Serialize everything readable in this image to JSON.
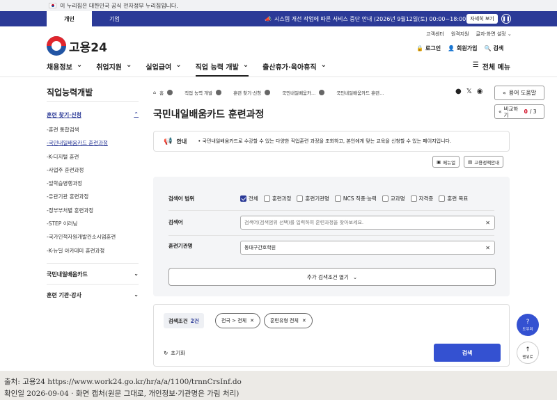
{
  "gov_bar": {
    "text": "이 누리집은 대한민국 공식 전자정부 누리집입니다."
  },
  "notice": {
    "tab_member": "개인",
    "tab_business": "기업",
    "message": "시스템 개선 작업에 따른 서비스 중단 안내 (2026년 9월12일(토) 00:00~18:00)",
    "more_label": "자세히 보기",
    "pause_icon": "pause-icon"
  },
  "util_links": [
    "고객센터",
    "원격지원",
    "글자·화면 설정"
  ],
  "logo": {
    "text": "고용24"
  },
  "user_tools": {
    "login": "로그인",
    "signup": "회원가입",
    "search": "검색"
  },
  "gnb": {
    "items": [
      "채용정보",
      "취업지원",
      "실업급여",
      "직업 능력 개발",
      "출산휴가·육아휴직"
    ],
    "active_index": 3,
    "all_menu": "전체 메뉴"
  },
  "lnb": {
    "title": "직업능력개발",
    "group_head": "훈련 찾기·신청",
    "sub_items": [
      "-훈련 통합검색",
      "-국민내일배움카드 훈련과정",
      "-K-디지털 훈련",
      "-사업주 훈련과정",
      "-일학습병행과정",
      "-유관기관 훈련과정",
      "-정부부처별 훈련과정",
      "-STEP 이러닝",
      "-국가인적자원개발컨소시엄훈련",
      "-K-뉴딜 아카데미 훈련과정"
    ],
    "active_sub_index": 1,
    "groups": [
      "국민내일배움카드",
      "훈련 기관·강사"
    ]
  },
  "breadcrumb": [
    "홈",
    "직업 능력 개발",
    "훈련 찾기·신청",
    "국민내일배움카...",
    "국민내일배움카드 훈련..."
  ],
  "header_tools": {
    "help_label": "용어 도움말",
    "compare_label": "비교하기",
    "compare_count": "0",
    "compare_total": "/ 3"
  },
  "page": {
    "title": "국민내일배움카드 훈련과정"
  },
  "info": {
    "label": "안내",
    "text": "• 국민내일배움카드로 수강할 수 있는 다양한 직업훈련 과정을 조회하고, 본인에게 맞는 교육을 신청할 수 있는 페이지입니다."
  },
  "doc_buttons": [
    "메뉴얼",
    "고용정책안내"
  ],
  "search": {
    "scope_label": "검색어 범위",
    "scope_options": [
      {
        "label": "전체",
        "checked": true
      },
      {
        "label": "훈련과정",
        "checked": false
      },
      {
        "label": "훈련기관명",
        "checked": false
      },
      {
        "label": "NCS 직종·능력",
        "checked": false
      },
      {
        "label": "교과명",
        "checked": false
      },
      {
        "label": "자격증",
        "checked": false
      },
      {
        "label": "훈련 목표",
        "checked": false
      }
    ],
    "keyword_label": "검색어",
    "keyword_placeholder": "검색어(검색범위 선택)를 입력하여 훈련과정을 찾아보세요.",
    "institution_label": "훈련기관명",
    "institution_value": "동대구간호학원",
    "more_conditions": "추가 검색조건 열기"
  },
  "conditions": {
    "label": "검색조건",
    "count": "2건",
    "chips": [
      "전국 > 전체",
      "훈련유형 전체"
    ],
    "reset": "초기화",
    "search_button": "검색"
  },
  "float": {
    "help": "도우미",
    "top": "맨위로"
  },
  "caption": {
    "line1": "출처: 고용24  https://www.work24.go.kr/hr/a/a/1100/trnnCrsInf.do",
    "line2": "확인일 2026-09-04 · 화면 캡처(원문 그대로, 개인정보·기관명은 가림 처리)"
  }
}
